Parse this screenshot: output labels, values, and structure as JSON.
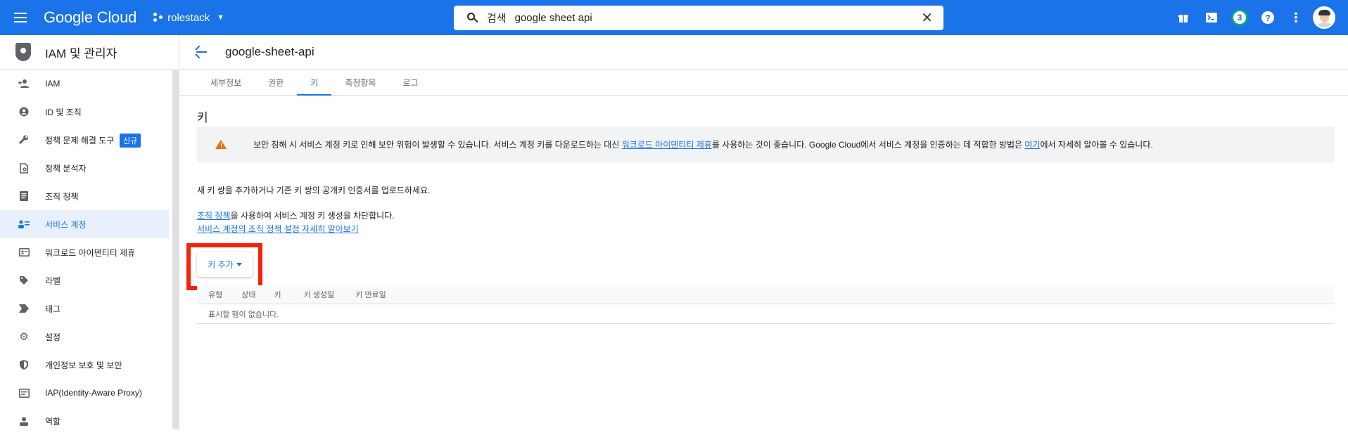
{
  "topbar": {
    "brand": "Google Cloud",
    "project": "rolestack",
    "search_label": "검색",
    "search_value": "google sheet api",
    "notification_count": "3",
    "icons": [
      "menu-icon",
      "gift-icon",
      "terminal-icon",
      "notifications-icon",
      "help-icon",
      "more-vert-icon",
      "avatar"
    ]
  },
  "sidebar": {
    "title": "IAM 및 관리자",
    "items": [
      {
        "label": "IAM",
        "icon": "person-add-icon"
      },
      {
        "label": "ID 및 조직",
        "icon": "account-circle-icon"
      },
      {
        "label": "정책 문제 해결 도구",
        "icon": "wrench-icon",
        "badge": "신규"
      },
      {
        "label": "정책 분석자",
        "icon": "policy-analyzer-icon"
      },
      {
        "label": "조직 정책",
        "icon": "document-icon"
      },
      {
        "label": "서비스 계정",
        "icon": "service-account-icon",
        "active": true
      },
      {
        "label": "워크로드 아이덴티티 제휴",
        "icon": "id-card-icon"
      },
      {
        "label": "라벨",
        "icon": "label-icon"
      },
      {
        "label": "태그",
        "icon": "tag-arrow-icon"
      },
      {
        "label": "설정",
        "icon": "gear-icon"
      },
      {
        "label": "개인정보 보호 및 보안",
        "icon": "shield-icon"
      },
      {
        "label": "IAP(Identity-Aware Proxy)",
        "icon": "iap-icon"
      },
      {
        "label": "역할",
        "icon": "roles-icon"
      }
    ]
  },
  "page": {
    "title": "google-sheet-api",
    "tabs": [
      "세부정보",
      "권한",
      "키",
      "측정항목",
      "로그"
    ],
    "active_tab": "키"
  },
  "keys": {
    "heading": "키",
    "warning_pre": "보안 침해 시 서비스 계정 키로 인해 보안 위험이 발생할 수 있습니다. 서비스 계정 키를 다운로드하는 대신 ",
    "warning_link1": "워크로드 아이덴티티 제휴",
    "warning_mid": "를 사용하는 것이 좋습니다. Google Cloud에서 서비스 계정을 인증하는 데 적합한 방법은 ",
    "warning_link2": "여기",
    "warning_post": "에서 자세히 알아볼 수 있습니다.",
    "intro": "새 키 쌍을 추가하거나 기존 키 쌍의 공개키 인증서를 업로드하세요.",
    "org_policy_link": "조직 정책",
    "org_policy_text": "을 사용하여 서비스 계정 키 생성을 차단합니다.",
    "learn_more_link": "서비스 계정의 조직 정책 설정 자세히 알아보기",
    "add_key_label": "키 추가",
    "columns": [
      "유형",
      "상태",
      "키",
      "키 생성일",
      "키 만료일"
    ],
    "empty_text": "표시할 행이 없습니다."
  },
  "colors": {
    "accent": "#1a73e8",
    "highlight_box": "#f4230b",
    "warning": "#e37400"
  }
}
